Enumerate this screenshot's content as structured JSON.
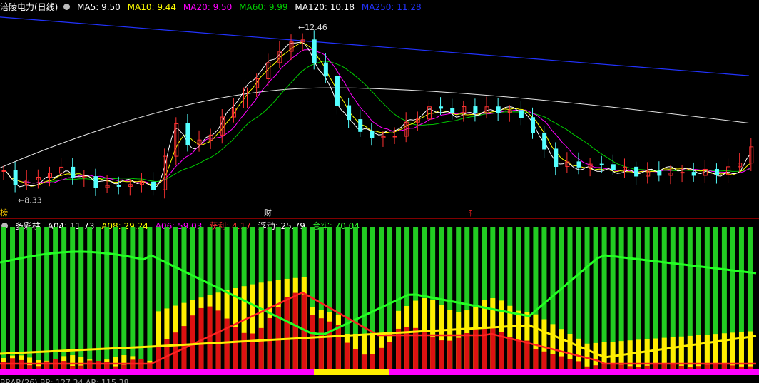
{
  "main_chart": {
    "stock_name": "涪陵电力(日线)",
    "indicators": [
      {
        "label": "MA5: 9.50",
        "color": "#ffffff"
      },
      {
        "label": "MA10: 9.44",
        "color": "#ffff00"
      },
      {
        "label": "MA20: 9.50",
        "color": "#ff00ff"
      },
      {
        "label": "MA60: 9.99",
        "color": "#00cc00"
      },
      {
        "label": "MA120: 10.18",
        "color": "#ffffff"
      },
      {
        "label": "MA250: 11.28",
        "color": "#2233ff"
      }
    ],
    "high_label": "12.46",
    "low_label": "8.33",
    "markers": [
      {
        "text": "财",
        "color": "#ffffff"
      },
      {
        "text": "$",
        "color": "#ff2222"
      }
    ],
    "left_edge_label": "榜"
  },
  "indicator_panel": {
    "name": "多彩柱",
    "values": [
      {
        "label": "A04: 11.73",
        "color": "#ffffff"
      },
      {
        "label": "A08: 29.24",
        "color": "#ffff00"
      },
      {
        "label": "A06: 59.03",
        "color": "#ff00ff"
      },
      {
        "label": "获利: 4.17",
        "color": "#ff3333"
      },
      {
        "label": "浮动: 25.79",
        "color": "#ffffff"
      },
      {
        "label": "套牢: 70.04",
        "color": "#33ff33"
      }
    ]
  },
  "bottom_indicator_label": "BRAR(26)  BR: 127.34  AR: 115.38",
  "chart_data": {
    "type": "candlestick",
    "price_range": [
      8.0,
      12.8
    ],
    "high": 12.46,
    "low": 8.33,
    "colors": {
      "up": "#ff3232",
      "down": "#54ffff",
      "ma5": "#ffffff",
      "ma10": "#ffff00",
      "ma20": "#ff00ff",
      "ma60": "#00cc00",
      "ma120": "#ffffff",
      "ma250": "#2233ff"
    }
  }
}
